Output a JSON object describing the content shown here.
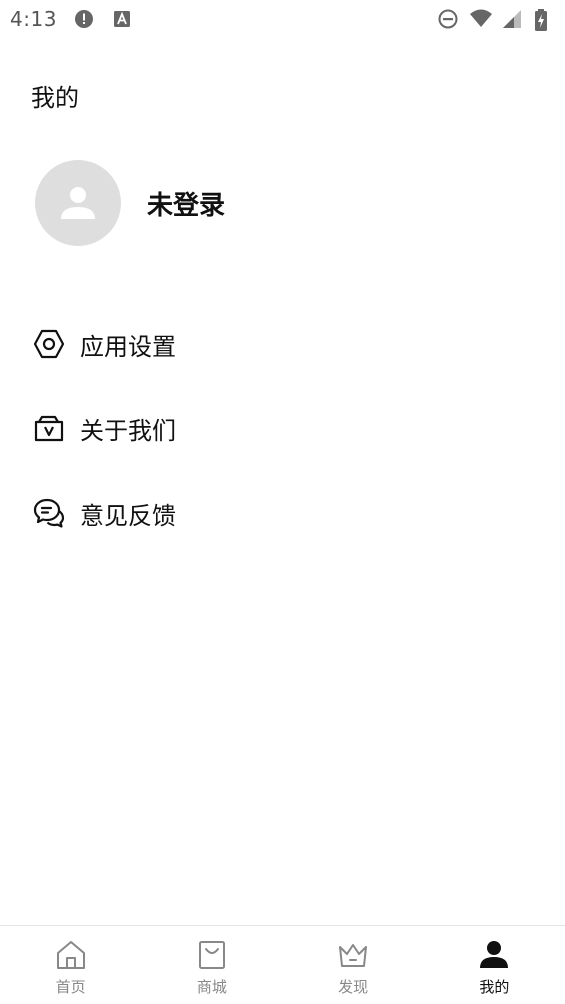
{
  "status_bar": {
    "time": "4:13",
    "left_icons": [
      "alert-circle-icon",
      "keyboard-a-icon"
    ],
    "right_icons": [
      "do-not-disturb-icon",
      "wifi-icon",
      "cell-signal-icon",
      "battery-charging-icon"
    ]
  },
  "header": {
    "title": "我的"
  },
  "profile": {
    "avatar_icon": "person-icon",
    "name": "未登录"
  },
  "menu": {
    "items": [
      {
        "label": "应用设置",
        "icon": "hexagon-settings-icon"
      },
      {
        "label": "关于我们",
        "icon": "folder-v-icon"
      },
      {
        "label": "意见反馈",
        "icon": "chat-bubbles-icon"
      }
    ]
  },
  "bottom_nav": {
    "items": [
      {
        "label": "首页",
        "icon": "home-icon",
        "active": false
      },
      {
        "label": "商城",
        "icon": "shopping-bag-icon",
        "active": false
      },
      {
        "label": "发现",
        "icon": "crown-icon",
        "active": false
      },
      {
        "label": "我的",
        "icon": "person-icon",
        "active": true
      }
    ]
  },
  "colors": {
    "active": "#111111",
    "inactive": "#888888",
    "avatar_bg": "#dedede"
  }
}
